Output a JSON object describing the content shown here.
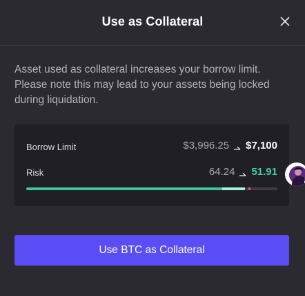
{
  "modal": {
    "title": "Use as Collateral",
    "description": "Asset used as collateral increases your borrow limit. Please note this may lead to your assets being locked during liquidation."
  },
  "borrow_limit": {
    "label": "Borrow Limit",
    "current": "$3,996.25",
    "new": "$7,100"
  },
  "risk": {
    "label": "Risk",
    "current": "64.24",
    "new": "51.91",
    "bar_new_fraction": 0.78,
    "bar_current_fraction": 0.87,
    "marker_fraction": 0.885
  },
  "cta": {
    "label": "Use BTC as Collateral"
  },
  "icons": {
    "close": "close-icon",
    "arrow": "arrow-right-icon",
    "avatar": "avatar"
  },
  "colors": {
    "background": "#2a2a30",
    "card": "#1f1f25",
    "accent": "#5b4df5",
    "positive": "#3fd1a3",
    "risk_marker": "#e0527a"
  }
}
